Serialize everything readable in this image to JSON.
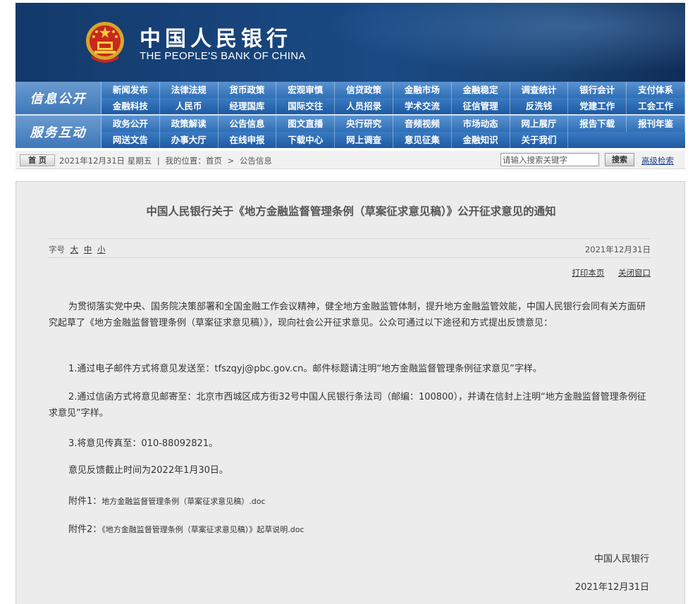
{
  "header": {
    "bank_name_cn": "中国人民银行",
    "bank_name_en": "THE PEOPLE'S BANK OF CHINA",
    "emblem_icon": "national-emblem-icon",
    "colors": {
      "banner": "#1a4a84",
      "nav": "#2f6fb5",
      "label": "#4a83c2"
    }
  },
  "nav": {
    "info_label": "信息公开",
    "info_row1": [
      "新闻发布",
      "法律法规",
      "货币政策",
      "宏观审慎",
      "信贷政策",
      "金融市场",
      "金融稳定",
      "调查统计",
      "银行会计",
      "支付体系"
    ],
    "info_row2": [
      "金融科技",
      "人民币",
      "经理国库",
      "国际交往",
      "人员招录",
      "学术交流",
      "征信管理",
      "反洗钱",
      "党建工作",
      "工会工作"
    ],
    "service_label": "服务互动",
    "service_row1": [
      "政务公开",
      "政策解读",
      "公告信息",
      "图文直播",
      "央行研究",
      "音频视频",
      "市场动态",
      "网上展厅",
      "报告下载",
      "报刊年鉴"
    ],
    "service_row2": [
      "网送文告",
      "办事大厅",
      "在线申报",
      "下载中心",
      "网上调查",
      "意见征集",
      "金融知识",
      "关于我们"
    ]
  },
  "breadcrumb": {
    "home_label": "首 页",
    "date": "2021年12月31日 星期五",
    "sep": "|",
    "location_label": "我的位置：首页",
    "arrow": ">",
    "current": "公告信息",
    "search_placeholder": "请输入搜索关键字",
    "search_button": "搜索",
    "advanced_search": "高级检索"
  },
  "article": {
    "title": "中国人民银行关于《地方金融监督管理条例（草案征求意见稿）》公开征求意见的通知",
    "font_size_label": "字号",
    "font_sizes": [
      "大",
      "中",
      "小"
    ],
    "publish_date": "2021年12月31日",
    "print_label": "打印本页",
    "close_label": "关闭窗口",
    "p1": "为贯彻落实党中央、国务院决策部署和全国金融工作会议精神，健全地方金融监管体制，提升地方金融监管效能，中国人民银行会同有关方面研究起草了《地方金融监督管理条例（草案征求意见稿）》，现向社会公开征求意见。公众可通过以下途径和方式提出反馈意见：",
    "p2": "1.通过电子邮件方式将意见发送至：tfszqyj@pbc.gov.cn。邮件标题请注明“地方金融监督管理条例征求意见”字样。",
    "p3": "2.通过信函方式将意见邮寄至：北京市西城区成方街32号中国人民银行条法司（邮编：100800），并请在信封上注明“地方金融监督管理条例征求意见”字样。",
    "p4": "3.将意见传真至：010-88092821。",
    "p5": "意见反馈截止时间为2022年1月30日。",
    "attach1_label": "附件1：",
    "attach1_file": "地方金融监督管理条例（草案征求意见稿）.doc",
    "attach2_label": "附件2：",
    "attach2_file": "《地方金融监督管理条例（草案征求意见稿）》起草说明.doc",
    "signature": "中国人民银行",
    "sign_date": "2021年12月31日"
  }
}
